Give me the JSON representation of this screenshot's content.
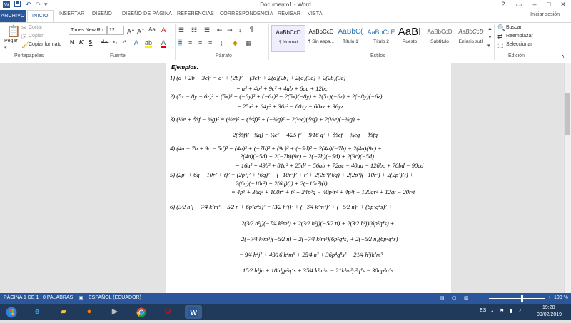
{
  "window": {
    "title": "Documento1 - Word",
    "help": "?",
    "controls": [
      "–",
      "□",
      "✕"
    ]
  },
  "tabs": {
    "file": "ARCHIVO",
    "items": [
      "INICIO",
      "INSERTAR",
      "DISEÑO",
      "DISEÑO DE PÁGINA",
      "REFERENCIAS",
      "CORRESPONDENCIA",
      "REVISAR",
      "VISTA"
    ],
    "signin": "Iniciar sesión"
  },
  "ribbon": {
    "clipboard": {
      "paste": "Pegar",
      "cut": "Cortar",
      "copy": "Copiar",
      "format_painter": "Copiar formato",
      "label": "Portapapeles"
    },
    "font": {
      "name": "Times New Ro",
      "size": "12",
      "case": "Aa",
      "label": "Fuente",
      "buttons": [
        "N",
        "K",
        "S",
        "abc",
        "x₂",
        "x²"
      ]
    },
    "paragraph": {
      "label": "Párrafo",
      "show_marks": "¶"
    },
    "styles": {
      "label": "Estilos",
      "items": [
        {
          "preview": "AaBbCcD",
          "name": "¶ Normal",
          "selected": true
        },
        {
          "preview": "AaBbCcD",
          "name": "¶ Sin espa..."
        },
        {
          "preview": "AaBbC(",
          "name": "Título 1"
        },
        {
          "preview": "AaBbCcE",
          "name": "Título 2"
        },
        {
          "preview": "AaBI",
          "name": "Puesto"
        },
        {
          "preview": "AaBbCcD",
          "name": "Subtítulo"
        },
        {
          "preview": "AaBbCcD",
          "name": "Énfasis sutil"
        }
      ]
    },
    "editing": {
      "find": "Buscar",
      "replace": "Reemplazar",
      "select": "Seleccionar",
      "label": "Edición"
    }
  },
  "document": {
    "heading": "Ejemplos.",
    "lines": [
      "1)  (a + 2b + 3c)² = a² + (2b)² + (3c)² + 2(a)(2b) + 2(a)(3c) + 2(2b)(3c)",
      "= a² + 4b² + 9c² + 4ab + 6ac + 12bc",
      "2)  (5x − 8y − 6z)² = (5x)² + (−8y)² + (−6z)² + 2(5x)(−8y) + 2(5x)(−6z) + 2(−8y)(−6z)",
      "= 25x² + 64y² + 36z² − 80xy − 60xz + 96yz",
      "3)  (½e + ⅖f − ¾g)² = (½e)² + (⅖f)² + (−¾g)² + 2(½e)(⅖f) + 2(½e)(−¾g) +",
      "2(⅖f)(−¾g) = ¼e² + 4⁄25 f² + 9⁄16 g² + ⅖ef − ¾eg − ⅗fg",
      "4)  (4a − 7b + 9c − 5d)² = (4a)² + (−7b)² + (9c)² + (−5d)² + 2(4a)(−7b) + 2(4a)(9c) +",
      "2(4a)(−5d) + 2(−7b)(9c) + 2(−7b)(−5d) + 2(9c)(−5d)",
      "= 16a² + 49b² + 81c² + 25d² − 56ab + 72ac − 40ad − 126bc + 70bd − 90cd",
      "5)  (2p³ + 6q − 10r² + t)² = (2p³)² + (6q)² + (−10r²)² + t² + 2(2p³)(6q) + 2(2p³)(−10r²) + 2(2p³)(t) +",
      "2(6q)(−10r²) + 2(6q)(t) + 2(−10r²)(t)",
      "= 4p⁶ + 36q² + 100r⁴ + t² + 24p³q − 40p³r² + 4p³t − 120qr² + 12qt − 20r²t",
      "6)  (3⁄2 h²j − 7⁄4 k²m³ − 5⁄2 n + 6p²q⁴s)² = (3⁄2 h²j)² + (−7⁄4 k²m³)² + (−5⁄2 n)² + (6p²q⁴s)² +",
      "2(3⁄2 h²j)(−7⁄4 k²m³) + 2(3⁄2 h²j)(−5⁄2 n) + 2(3⁄2 h²j)(6p²q⁴s) +",
      "2(−7⁄4 k²m³)(−5⁄2 n) + 2(−7⁄4 k²m³)(6p²q⁴s) + 2(−5⁄2 n)(6p²q⁴s)",
      "= 9⁄4 h⁴j² + 49⁄16 k⁴m⁶ + 25⁄4 n² + 36p⁴q⁸s² − 21⁄4 h²jk²m³ −",
      "15⁄2 h²jn + 18h²jp²q⁴s + 35⁄4 k²m³n − 21k²m³p²q⁴s − 30np²q⁴s"
    ]
  },
  "statusbar": {
    "page": "PÁGINA 1 DE 1",
    "words": "0 PALABRAS",
    "language": "ESPAÑOL (ECUADOR)",
    "zoom": "100 %",
    "zoom_level": 1.0
  },
  "taskbar": {
    "lang": "ES",
    "time": "19:28",
    "date": "09/02/2019"
  },
  "colors": {
    "word_blue": "#2b579a",
    "taskbar": "#1f3a5a"
  }
}
